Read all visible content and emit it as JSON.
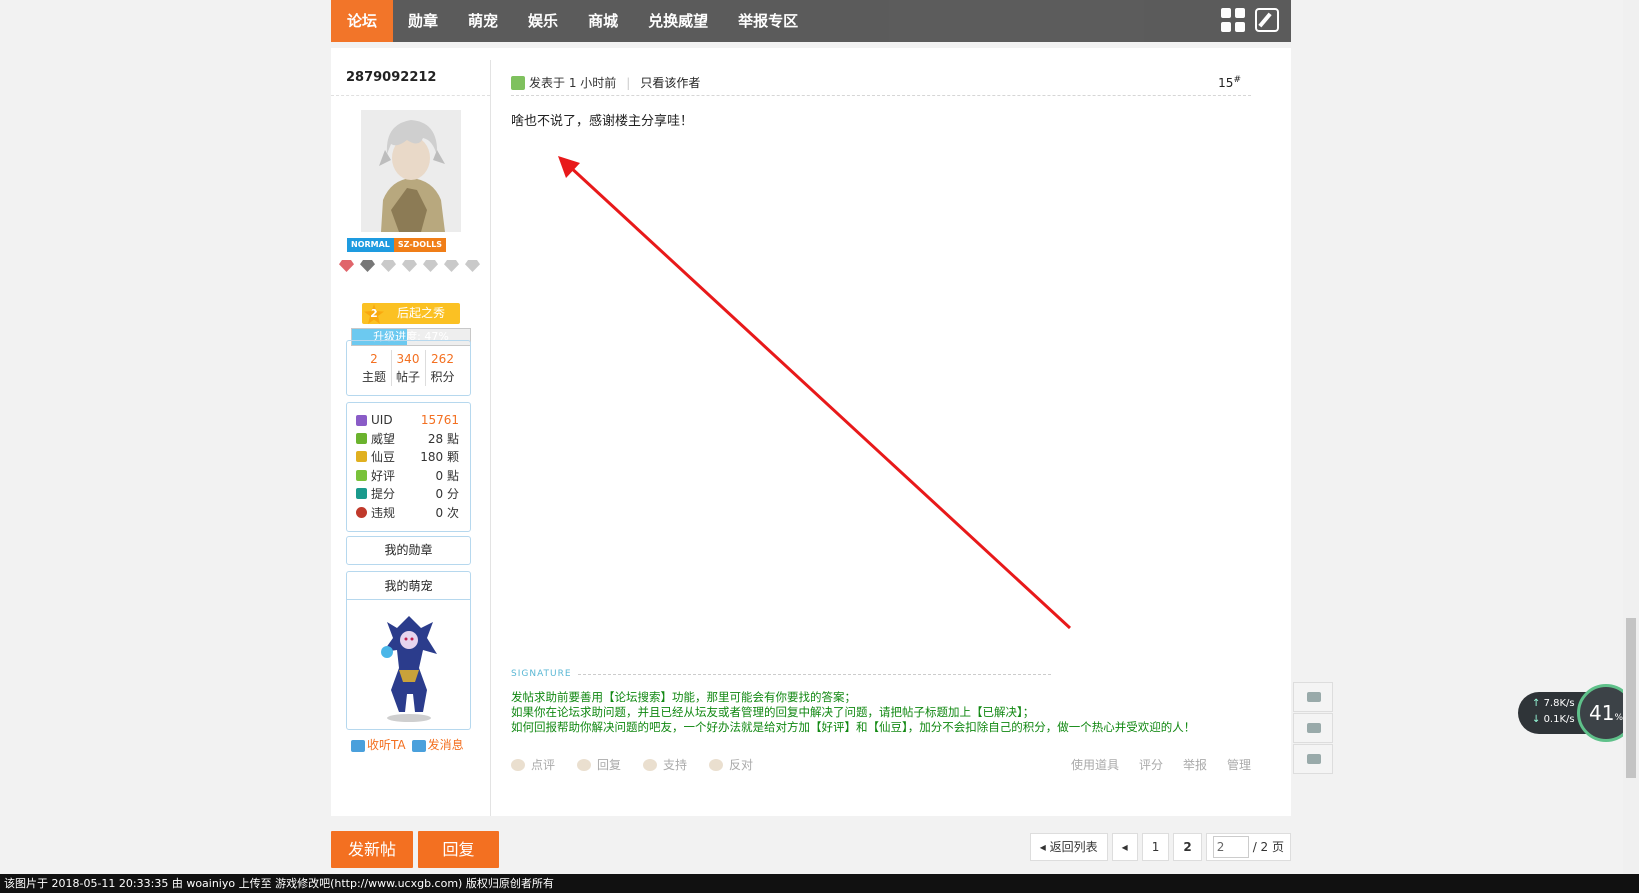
{
  "nav": {
    "tabs": [
      "论坛",
      "勋章",
      "萌宠",
      "娱乐",
      "商城",
      "兑换威望",
      "举报专区"
    ],
    "active_index": 0,
    "icons": [
      "grid-icon",
      "edit-icon"
    ]
  },
  "ghost_prev_actions": [
    "点评",
    "回复",
    "支持",
    "反对",
    "使用道具",
    "评分",
    "举报",
    "管理"
  ],
  "author": {
    "username": "2879092212",
    "group_badges": [
      "NORMAL",
      "SZ-DOLLS"
    ],
    "level_number": "2",
    "level_name": "后起之秀",
    "progress_label": "升级进度: 47%",
    "progress_value": 0.47,
    "stats": [
      {
        "value": "2",
        "label": "主题"
      },
      {
        "value": "340",
        "label": "帖子"
      },
      {
        "value": "262",
        "label": "积分"
      }
    ],
    "profile": [
      {
        "icon": "uid-icon",
        "label": "UID",
        "value": "15761",
        "color": "#8a5cc7"
      },
      {
        "icon": "prestige-icon",
        "label": "威望",
        "value": "28 點",
        "color": "#6bb32e"
      },
      {
        "icon": "bean-icon",
        "label": "仙豆",
        "value": "180 颗",
        "color": "#e0b020"
      },
      {
        "icon": "rating-icon",
        "label": "好评",
        "value": "0 點",
        "color": "#79c23a"
      },
      {
        "icon": "score-icon",
        "label": "提分",
        "value": "0 分",
        "color": "#1a9a8c"
      },
      {
        "icon": "violation-icon",
        "label": "违规",
        "value": "0 次",
        "color": "#c0392b"
      }
    ],
    "medal_button": "我的勋章",
    "pet_title": "我的萌宠",
    "follow_label": "收听TA",
    "message_label": "发消息"
  },
  "post": {
    "posted_label": "发表于",
    "posted_time": "1 小时前",
    "only_author": "只看该作者",
    "floor": "15",
    "floor_sup": "#",
    "body": "啥也不说了，感谢楼主分享哇！",
    "signature_label": "SIGNATURE",
    "signature_lines": [
      "发帖求助前要善用【论坛搜索】功能，那里可能会有你要找的答案；",
      "如果你在论坛求助问题，并且已经从坛友或者管理的回复中解决了问题，请把帖子标题加上【已解决】；",
      "如何回报帮助你解决问题的吧友，一个好办法就是给对方加【好评】和【仙豆】，加分不会扣除自己的积分，做一个热心并受欢迎的人！"
    ],
    "actions": [
      "点评",
      "回复",
      "支持",
      "反对"
    ],
    "actions_right": [
      "使用道具",
      "评分",
      "举报",
      "管理"
    ]
  },
  "bottom": {
    "new_post": "发新帖",
    "reply": "回复",
    "back_to_list": "返回列表",
    "pages": [
      "1",
      "2"
    ],
    "current_page": "2",
    "page_input": "2",
    "page_total": "/ 2 页"
  },
  "widget": {
    "upload": "7.8K/s",
    "download": "0.1K/s",
    "percent": "41",
    "percent_unit": "%"
  },
  "footer": "该图片于 2018-05-11 20:33:35 由 woainiyo 上传至 游戏修改吧(http://www.ucxgb.com) 版权归原创者所有",
  "colors": {
    "accent": "#f37021",
    "nav_bg": "#555555",
    "signature": "#118812",
    "arrow": "#e8191a"
  }
}
